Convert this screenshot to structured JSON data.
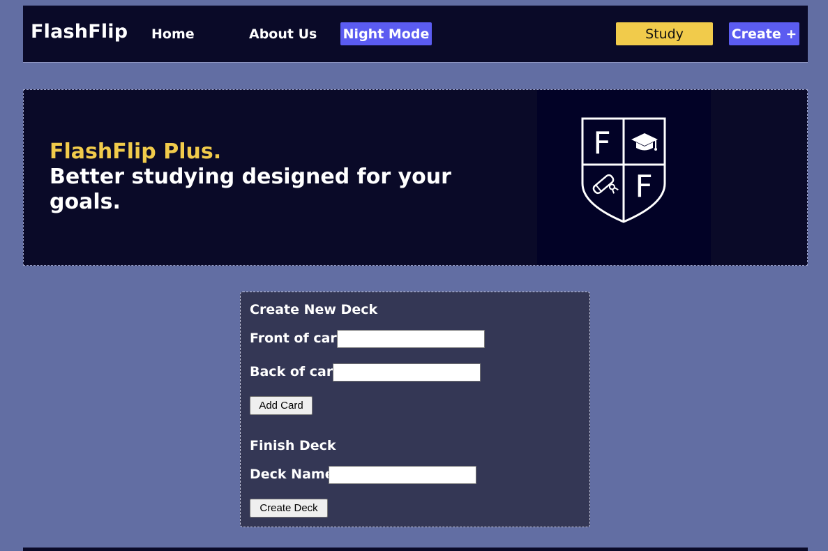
{
  "nav": {
    "brand": "FlashFlip",
    "links": [
      "Home",
      "About Us"
    ],
    "night_mode_label": "Night Mode",
    "study_label": "Study",
    "create_label": "Create +"
  },
  "hero": {
    "title": "FlashFlip Plus.",
    "subtitle": "Better studying designed for your goals.",
    "logo_letters": [
      "F",
      "F"
    ]
  },
  "form": {
    "create_heading": "Create New Deck",
    "front_label": "Front of card:",
    "front_value": "",
    "back_label": "Back of card:",
    "back_value": "",
    "add_card_label": "Add Card",
    "finish_heading": "Finish Deck",
    "deck_name_label": "Deck Name:",
    "deck_name_value": "",
    "create_deck_label": "Create Deck"
  },
  "colors": {
    "page_background": "#626ea3",
    "nav_background": "#0a0a28",
    "accent_blue": "#5b5cf1",
    "accent_yellow": "#f1cb4b",
    "form_background": "#343755"
  },
  "icons": [
    "crest-logo-icon",
    "graduation-cap-icon",
    "diploma-icon"
  ]
}
